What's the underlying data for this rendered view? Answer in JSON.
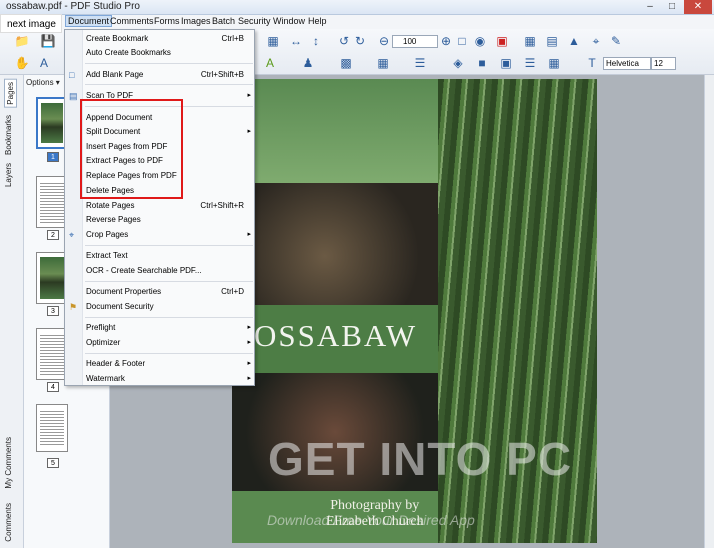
{
  "window": {
    "title": "ossabaw.pdf - PDF Studio Pro",
    "minimize": "–",
    "maximize": "□",
    "close": "✕"
  },
  "overlay": {
    "next_image": "next image"
  },
  "menubar": {
    "items": [
      "Document",
      "Comments",
      "Forms",
      "Images",
      "Batch",
      "Security",
      "Window",
      "Help"
    ]
  },
  "toolbar": {
    "zoom_value": "100",
    "font_name": "Helvetica",
    "font_size": "12",
    "icons": [
      "open-folder-icon",
      "save-icon",
      "copy-pages-icon",
      "fit-width-icon",
      "fit-page-icon",
      "rotate-ccw-icon",
      "rotate-cw-icon",
      "zoom-out-icon",
      "zoom-in-icon",
      "marquee-zoom-icon",
      "snapshot-icon",
      "stamp-icon",
      "text-color-icon",
      "stamp-person-icon",
      "image-icon",
      "grid-icon",
      "align-icon",
      "fill-color-icon",
      "border-color-icon",
      "line-style-icon",
      "opacity-icon",
      "text-tool-icon",
      "typewriter-icon"
    ]
  },
  "side_tabs": [
    "Pages",
    "Bookmarks",
    "Layers",
    "My Comments",
    "Comments"
  ],
  "thumbs": {
    "options_label": "Options ▾",
    "pages": [
      "1",
      "2",
      "3",
      "4",
      "5"
    ],
    "selected": "1"
  },
  "document_menu": {
    "items": [
      {
        "label": "Create Bookmark",
        "shortcut": "Ctrl+B"
      },
      {
        "label": "Auto Create Bookmarks",
        "shortcut": ""
      },
      {
        "label": "Add Blank Page",
        "shortcut": "Ctrl+Shift+B"
      },
      {
        "label": "Scan To PDF",
        "shortcut": ""
      },
      {
        "label": "Append Document",
        "shortcut": ""
      },
      {
        "label": "Split Document",
        "shortcut": ""
      },
      {
        "label": "Insert Pages from PDF",
        "shortcut": ""
      },
      {
        "label": "Extract Pages to PDF",
        "shortcut": ""
      },
      {
        "label": "Replace Pages from PDF",
        "shortcut": ""
      },
      {
        "label": "Delete Pages",
        "shortcut": ""
      },
      {
        "label": "Rotate Pages",
        "shortcut": "Ctrl+Shift+R"
      },
      {
        "label": "Reverse Pages",
        "shortcut": ""
      },
      {
        "label": "Crop Pages",
        "shortcut": ""
      },
      {
        "label": "Extract Text",
        "shortcut": ""
      },
      {
        "label": "OCR - Create Searchable PDF...",
        "shortcut": ""
      },
      {
        "label": "Document Properties",
        "shortcut": "Ctrl+D"
      },
      {
        "label": "Document Security",
        "shortcut": ""
      },
      {
        "label": "Preflight",
        "shortcut": ""
      },
      {
        "label": "Optimizer",
        "shortcut": ""
      },
      {
        "label": "Header & Footer",
        "shortcut": ""
      },
      {
        "label": "Watermark",
        "shortcut": ""
      }
    ],
    "submenu_arrow": "▸"
  },
  "page_content": {
    "title": "OSSABAW",
    "credit_line1": "Photography by",
    "credit_line2": "Elizabeth Church"
  },
  "watermark": {
    "text": "GET INTO PC",
    "subtext": "Download Free Your Desired App"
  },
  "colors": {
    "highlight_box": "#e01919",
    "accent": "#3b78c8"
  }
}
